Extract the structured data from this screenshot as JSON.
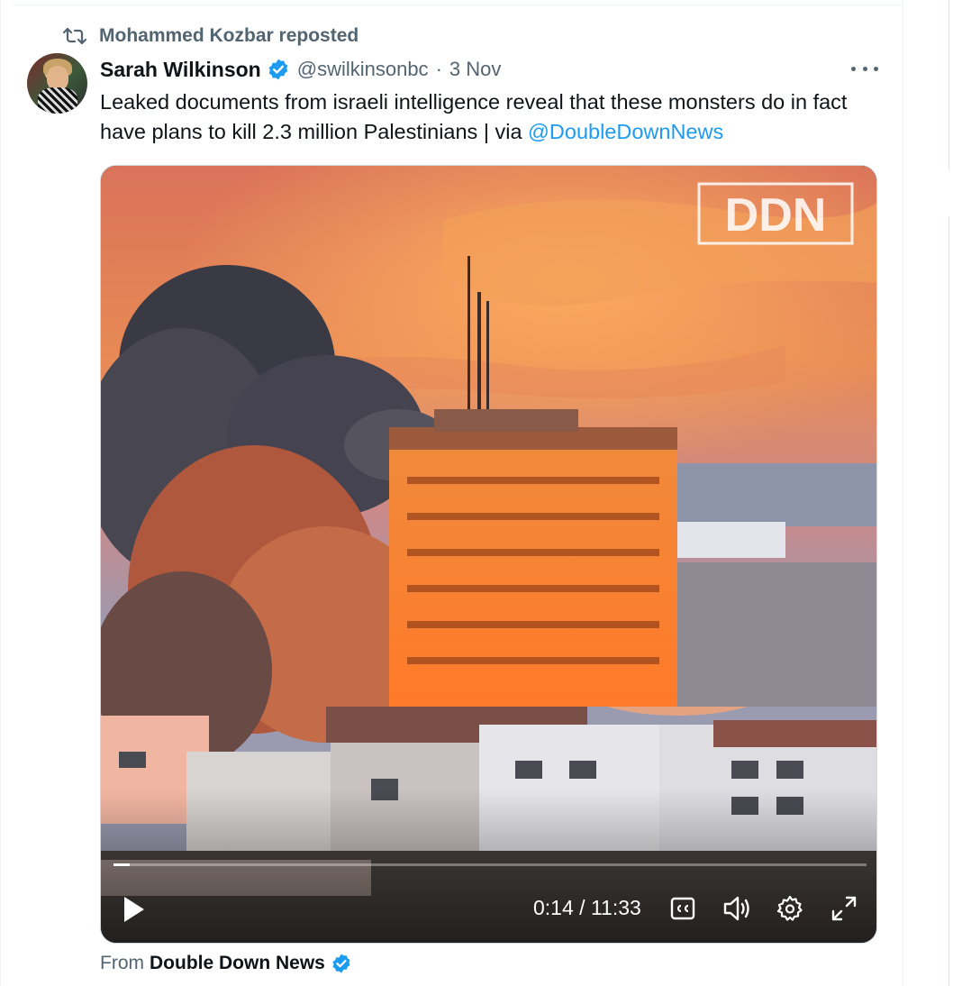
{
  "repost": {
    "text": "Mohammed Kozbar reposted"
  },
  "author": {
    "name": "Sarah Wilkinson",
    "handle": "@swilkinsonbc",
    "separator": "·",
    "date": "3 Nov"
  },
  "tweet": {
    "text": "Leaked documents from israeli intelligence reveal that these monsters do in fact have plans to kill 2.3 million Palestinians | via ",
    "mention": "@DoubleDownNews"
  },
  "video": {
    "watermark": "DDN",
    "current_time": "0:14",
    "separator": "/",
    "duration": "11:33",
    "progress_fraction": 0.021
  },
  "source": {
    "prefix": "From",
    "name": "Double Down News"
  },
  "colors": {
    "accent": "#1d9bf0",
    "text_primary": "#0f1419",
    "text_secondary": "#536471"
  },
  "icons": [
    "repost-icon",
    "verified-badge-icon",
    "more-icon",
    "play-icon",
    "closed-captions-icon",
    "volume-icon",
    "settings-gear-icon",
    "fullscreen-icon"
  ]
}
